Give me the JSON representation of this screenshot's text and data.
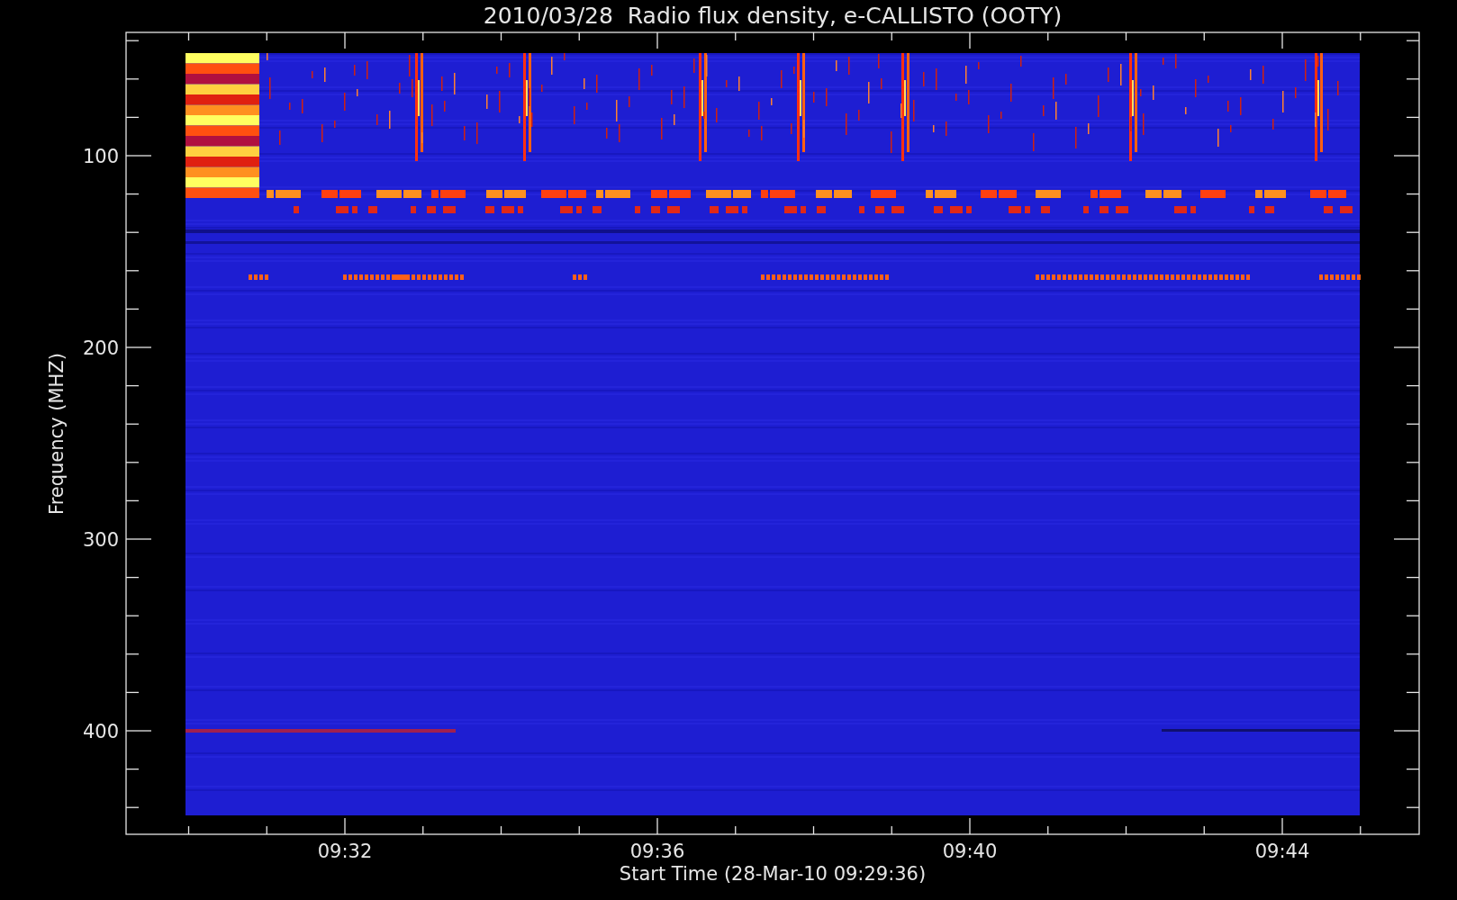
{
  "plot": {
    "title": "2010/03/28  Radio flux density, e-CALLISTO (OOTY)",
    "xlabel": "Start Time (28-Mar-10 09:29:36)",
    "ylabel": "Frequency (MHZ)",
    "xticks": [
      "09:32",
      "09:36",
      "09:40",
      "09:44"
    ],
    "yticks": [
      "100",
      "200",
      "300",
      "400"
    ]
  }
}
